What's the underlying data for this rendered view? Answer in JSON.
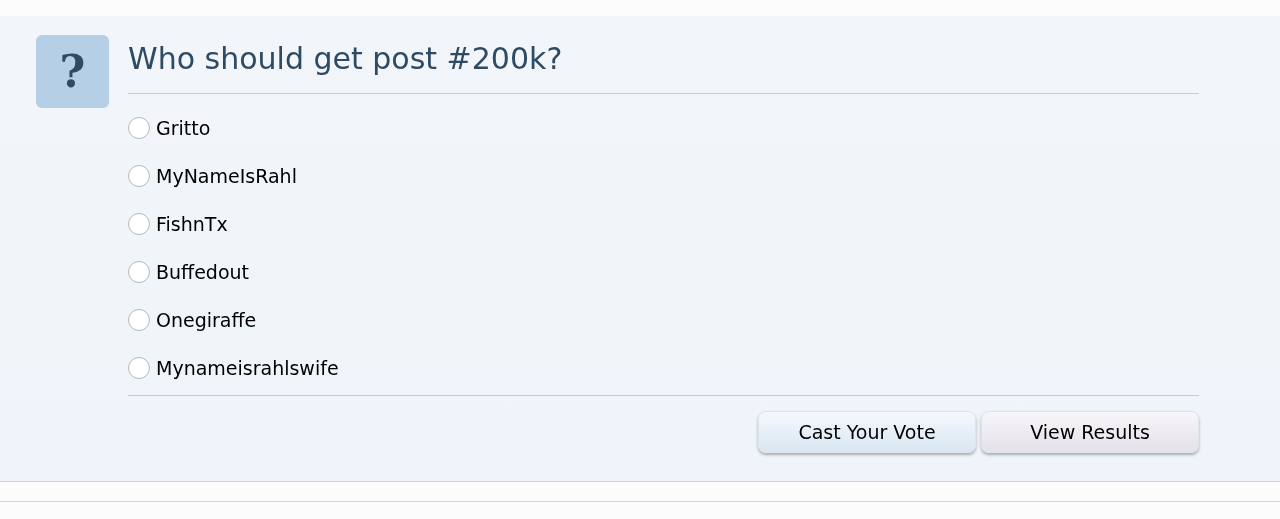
{
  "poll": {
    "icon_text": "?",
    "question": "Who should get post #200k?",
    "options": [
      {
        "label": "Gritto",
        "selected": false
      },
      {
        "label": "MyNameIsRahl",
        "selected": false
      },
      {
        "label": "FishnTx",
        "selected": false
      },
      {
        "label": "Buffedout",
        "selected": false
      },
      {
        "label": "Onegiraffe",
        "selected": false
      },
      {
        "label": "Mynameisrahlswife",
        "selected": false
      }
    ],
    "buttons": [
      {
        "label": "Cast Your Vote",
        "kind": "primary"
      },
      {
        "label": "View Results",
        "kind": "secondary"
      }
    ]
  }
}
